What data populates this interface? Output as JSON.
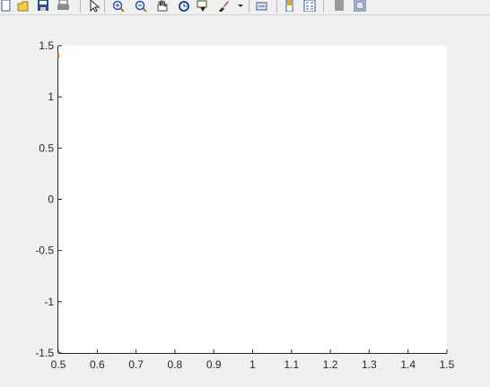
{
  "toolbar": {
    "buttons": [
      {
        "name": "new-figure-icon",
        "kind": "new"
      },
      {
        "name": "open-file-icon",
        "kind": "open"
      },
      {
        "name": "save-figure-icon",
        "kind": "save"
      },
      {
        "name": "print-figure-icon",
        "kind": "print"
      },
      {
        "name": "edit-plot-icon",
        "kind": "pointer"
      },
      {
        "name": "zoom-in-icon",
        "kind": "zoomin"
      },
      {
        "name": "zoom-out-icon",
        "kind": "zoomout"
      },
      {
        "name": "pan-icon",
        "kind": "pan"
      },
      {
        "name": "rotate-3d-icon",
        "kind": "rotate"
      },
      {
        "name": "data-cursor-icon",
        "kind": "datacursor"
      },
      {
        "name": "brush-icon",
        "kind": "brush"
      },
      {
        "name": "brush-dropdown-icon",
        "kind": "dropdown"
      },
      {
        "name": "link-plot-icon",
        "kind": "link"
      },
      {
        "name": "insert-colorbar-icon",
        "kind": "colorbar"
      },
      {
        "name": "insert-legend-icon",
        "kind": "legend"
      },
      {
        "name": "hide-plot-tools-icon",
        "kind": "hidetools"
      },
      {
        "name": "show-plot-tools-icon",
        "kind": "showtools"
      }
    ]
  },
  "chart_data": {
    "type": "line",
    "title": "",
    "xlabel": "",
    "ylabel": "",
    "xlim": [
      0.5,
      1.5
    ],
    "ylim": [
      -1.5,
      1.5
    ],
    "x_ticks": [
      "0.5",
      "0.6",
      "0.7",
      "0.8",
      "0.9",
      "1",
      "1.1",
      "1.2",
      "1.3",
      "1.4",
      "1.5"
    ],
    "y_ticks": [
      "1.5",
      "1",
      "0.5",
      "0",
      "-0.5",
      "-1",
      "-1.5"
    ],
    "x_tick_values": [
      0.5,
      0.6,
      0.7,
      0.8,
      0.9,
      1.0,
      1.1,
      1.2,
      1.3,
      1.4,
      1.5
    ],
    "y_tick_values": [
      1.5,
      1.0,
      0.5,
      0.0,
      -0.5,
      -1.0,
      -1.5
    ],
    "grid": false,
    "series": [
      {
        "x": [
          0.5
        ],
        "y": [
          1.4
        ],
        "color": "#d95319"
      }
    ],
    "colors": {
      "axes_bg": "#ffffff",
      "axis_line": "#262626",
      "figure_bg": "#f0f0f0"
    }
  }
}
